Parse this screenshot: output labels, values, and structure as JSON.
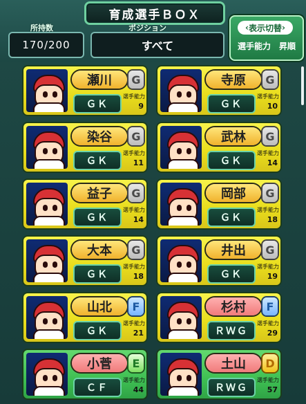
{
  "header": {
    "title": "育成選手ＢＯＸ",
    "count_label": "所持数",
    "count_value": "170/200",
    "position_label": "ポジション",
    "position_value": "すべて",
    "switch_label": "表示切替",
    "sort_value": "選手能力　昇順"
  },
  "cards": [
    {
      "name": "瀬川",
      "rank": "G",
      "position": "ＧＫ",
      "ability_label": "選手能力",
      "ability": "9",
      "card_color": "yellow",
      "name_color": "gold"
    },
    {
      "name": "寺原",
      "rank": "G",
      "position": "ＧＫ",
      "ability_label": "選手能力",
      "ability": "10",
      "card_color": "yellow",
      "name_color": "gold"
    },
    {
      "name": "染谷",
      "rank": "G",
      "position": "ＧＫ",
      "ability_label": "選手能力",
      "ability": "11",
      "card_color": "yellow",
      "name_color": "gold"
    },
    {
      "name": "武林",
      "rank": "G",
      "position": "ＧＫ",
      "ability_label": "選手能力",
      "ability": "14",
      "card_color": "yellow",
      "name_color": "gold"
    },
    {
      "name": "益子",
      "rank": "G",
      "position": "ＧＫ",
      "ability_label": "選手能力",
      "ability": "14",
      "card_color": "yellow",
      "name_color": "gold"
    },
    {
      "name": "岡部",
      "rank": "G",
      "position": "ＧＫ",
      "ability_label": "選手能力",
      "ability": "18",
      "card_color": "yellow",
      "name_color": "gold"
    },
    {
      "name": "大本",
      "rank": "G",
      "position": "ＧＫ",
      "ability_label": "選手能力",
      "ability": "18",
      "card_color": "yellow",
      "name_color": "gold"
    },
    {
      "name": "井出",
      "rank": "G",
      "position": "ＧＫ",
      "ability_label": "選手能力",
      "ability": "19",
      "card_color": "yellow",
      "name_color": "gold"
    },
    {
      "name": "山北",
      "rank": "F",
      "position": "ＧＫ",
      "ability_label": "選手能力",
      "ability": "21",
      "card_color": "yellow",
      "name_color": "gold"
    },
    {
      "name": "杉村",
      "rank": "F",
      "position": "ＲＷＧ",
      "ability_label": "選手能力",
      "ability": "29",
      "card_color": "yellow",
      "name_color": "pink"
    },
    {
      "name": "小菅",
      "rank": "E",
      "position": "ＣＦ",
      "ability_label": "選手能力",
      "ability": "44",
      "card_color": "green",
      "name_color": "pink"
    },
    {
      "name": "土山",
      "rank": "D",
      "position": "ＲＷＧ",
      "ability_label": "選手能力",
      "ability": "57",
      "card_color": "green",
      "name_color": "pink"
    }
  ]
}
